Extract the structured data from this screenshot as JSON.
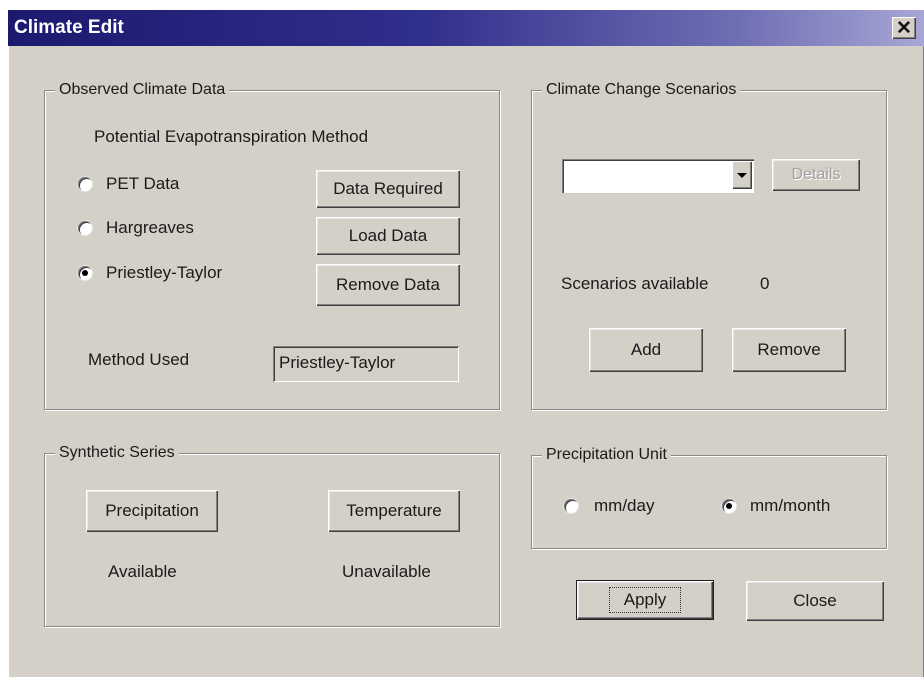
{
  "window": {
    "title": "Climate Edit",
    "close_glyph": "✕",
    "close_icon": "close-icon"
  },
  "observed": {
    "legend": "Observed Climate Data",
    "pet_heading": "Potential Evapotranspiration Method",
    "options": [
      {
        "label": "PET Data",
        "selected": false
      },
      {
        "label": "Hargreaves",
        "selected": false
      },
      {
        "label": "Priestley-Taylor",
        "selected": true
      }
    ],
    "buttons": {
      "data_required": "Data Required",
      "load_data": "Load Data",
      "remove_data": "Remove Data"
    },
    "method_used_label": "Method Used",
    "method_used_value": "Priestley-Taylor"
  },
  "scenarios": {
    "legend": "Climate Change Scenarios",
    "selected_scenario": "",
    "details_label": "Details",
    "available_label": "Scenarios available",
    "available_count": "0",
    "add_label": "Add",
    "remove_label": "Remove"
  },
  "synthetic": {
    "legend": "Synthetic Series",
    "precipitation_label": "Precipitation",
    "precipitation_status": "Available",
    "temperature_label": "Temperature",
    "temperature_status": "Unavailable"
  },
  "precip_unit": {
    "legend": "Precipitation Unit",
    "options": [
      {
        "label": "mm/day",
        "selected": false
      },
      {
        "label": "mm/month",
        "selected": true
      }
    ]
  },
  "footer": {
    "apply_label": "Apply",
    "close_label": "Close"
  },
  "colors": {
    "dialog": "#d4d0c8",
    "title_start": "#1c1a6e",
    "title_end": "#a7a7d6"
  }
}
